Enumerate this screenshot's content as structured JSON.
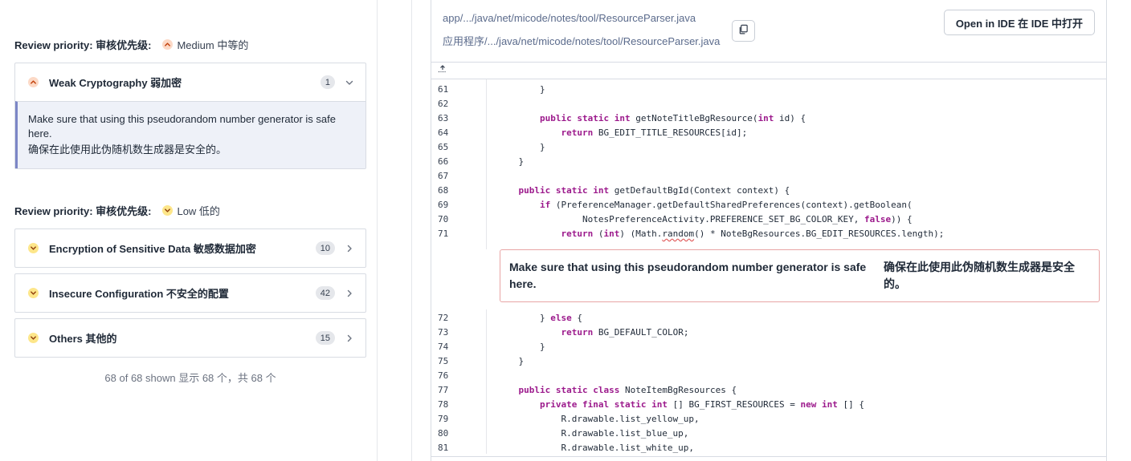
{
  "left": {
    "groups": [
      {
        "priority_label": "Review priority:  审核优先级:",
        "priority_value": "Medium  中等的",
        "issues": [
          {
            "title": "Weak Cryptography  弱加密",
            "count": "1",
            "expanded": true,
            "message_en": "Make sure that using this pseudorandom number generator is safe here.",
            "message_zh": "确保在此使用此伪随机数生成器是安全的。"
          }
        ]
      },
      {
        "priority_label": "Review priority:  审核优先级:",
        "priority_value": "Low  低的",
        "issues": [
          {
            "title": "Encryption of Sensitive Data  敏感数据加密",
            "count": "10"
          },
          {
            "title": "Insecure Configuration  不安全的配置",
            "count": "42"
          },
          {
            "title": "Others  其他的",
            "count": "15"
          }
        ]
      }
    ],
    "shown_text": "68 of 68 shown  显示 68 个，共 68 个"
  },
  "file": {
    "path_en": "app/.../java/net/micode/notes/tool/ResourceParser.java",
    "path_zh": "应用程序/.../java/net/micode/notes/tool/ResourceParser.java",
    "open_ide_label": "Open in IDE  在 IDE 中打开",
    "copy_icon": "copy-icon",
    "expand_icon": "expand-up-icon"
  },
  "code": {
    "lines_before": [
      {
        "n": "61",
        "text": "        }"
      },
      {
        "n": "62",
        "text": ""
      },
      {
        "n": "63",
        "text": "        public static int getNoteTitleBgResource(int id) {"
      },
      {
        "n": "64",
        "text": "            return BG_EDIT_TITLE_RESOURCES[id];"
      },
      {
        "n": "65",
        "text": "        }"
      },
      {
        "n": "66",
        "text": "    }"
      },
      {
        "n": "67",
        "text": ""
      },
      {
        "n": "68",
        "text": "    public static int getDefaultBgId(Context context) {"
      },
      {
        "n": "69",
        "text": "        if (PreferenceManager.getDefaultSharedPreferences(context).getBoolean("
      },
      {
        "n": "70",
        "text": "                NotesPreferenceActivity.PREFERENCE_SET_BG_COLOR_KEY, false)) {"
      },
      {
        "n": "71",
        "text": "            return (int) (Math.random() * NoteBgResources.BG_EDIT_RESOURCES.length);"
      }
    ],
    "inline_issue_en": "Make sure that using this pseudorandom number generator is safe here.",
    "inline_issue_zh": "确保在此使用此伪随机数生成器是安全的。",
    "lines_after": [
      {
        "n": "72",
        "text": "        } else {"
      },
      {
        "n": "73",
        "text": "            return BG_DEFAULT_COLOR;"
      },
      {
        "n": "74",
        "text": "        }"
      },
      {
        "n": "75",
        "text": "    }"
      },
      {
        "n": "76",
        "text": ""
      },
      {
        "n": "77",
        "text": "    public static class NoteItemBgResources {"
      },
      {
        "n": "78",
        "text": "        private final static int [] BG_FIRST_RESOURCES = new int [] {"
      },
      {
        "n": "79",
        "text": "            R.drawable.list_yellow_up,"
      },
      {
        "n": "80",
        "text": "            R.drawable.list_blue_up,"
      },
      {
        "n": "81",
        "text": "            R.drawable.list_white_up,"
      }
    ]
  },
  "colors": {
    "keyword": "#9c1a8c",
    "issue_border": "#e8a5a5",
    "medium_dot": "#fcd9c6",
    "low_dot": "#fde68a",
    "highlight_bar": "#7c86c6"
  }
}
